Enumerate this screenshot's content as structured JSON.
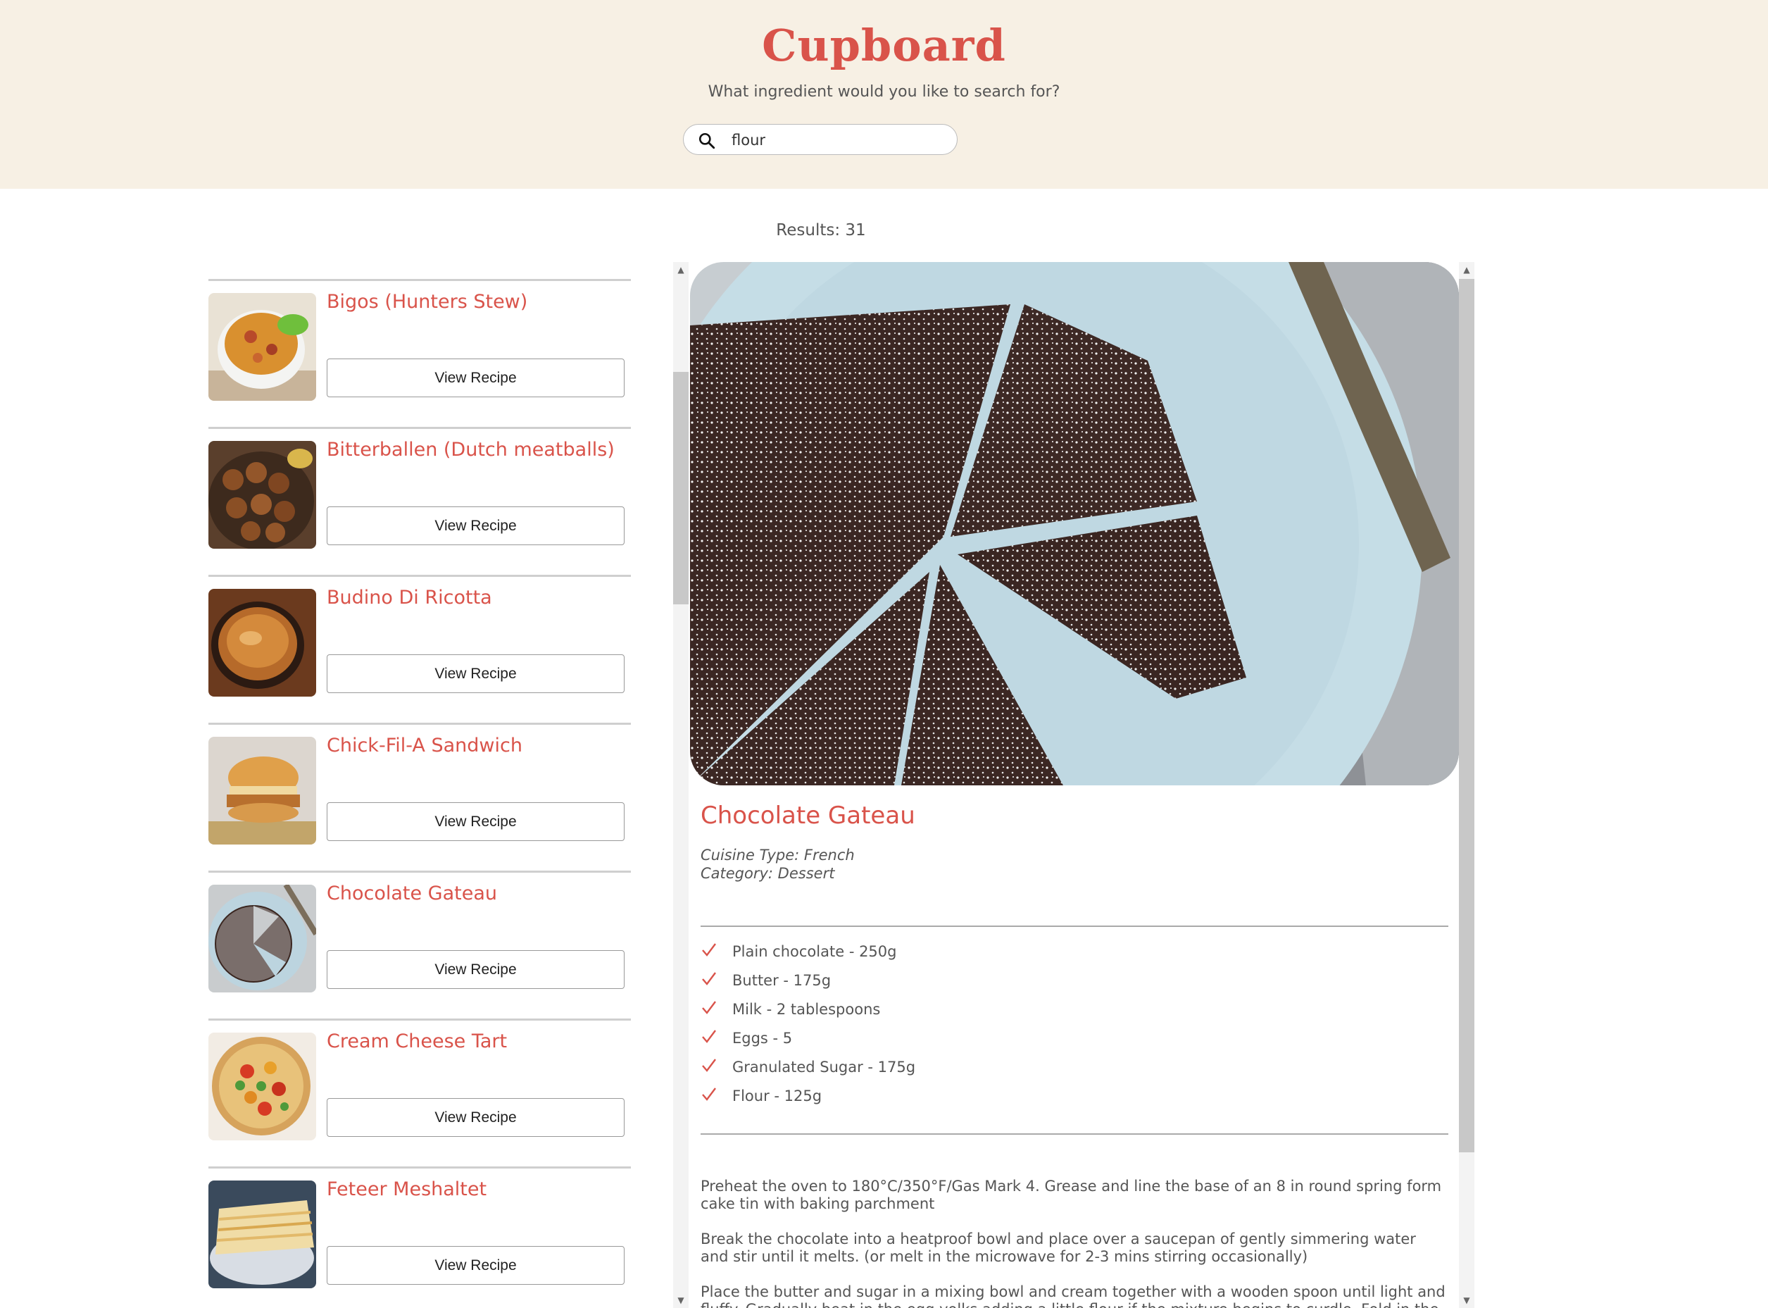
{
  "header": {
    "logo": "Cupboard",
    "subtitle": "What ingredient would you like to search for?",
    "search_value": "flour",
    "search_icon": "search-icon"
  },
  "results_label": "Results: 31",
  "recipes": [
    {
      "title": "Bigos (Hunters Stew)",
      "button": "View Recipe"
    },
    {
      "title": "Bitterballen (Dutch meatballs)",
      "button": "View Recipe"
    },
    {
      "title": "Budino Di Ricotta",
      "button": "View Recipe"
    },
    {
      "title": "Chick-Fil-A Sandwich",
      "button": "View Recipe"
    },
    {
      "title": "Chocolate Gateau",
      "button": "View Recipe"
    },
    {
      "title": "Cream Cheese Tart",
      "button": "View Recipe"
    },
    {
      "title": "Feteer Meshaltet",
      "button": "View Recipe"
    }
  ],
  "detail": {
    "title": "Chocolate Gateau",
    "cuisine": "Cuisine Type: French",
    "category": "Category: Dessert",
    "ingredients": [
      "Plain chocolate - 250g",
      "Butter - 175g",
      "Milk - 2 tablespoons",
      "Eggs - 5",
      "Granulated Sugar - 175g",
      "Flour - 125g"
    ],
    "instructions": [
      "Preheat the oven to 180°C/350°F/Gas Mark 4. Grease and line the base of an 8 in round spring form cake tin with baking parchment",
      "Break the chocolate into a heatproof bowl and place over a saucepan of gently simmering water and stir until it melts. (or melt in the microwave for 2-3 mins stirring occasionally)",
      "Place the butter and sugar in a mixing bowl and cream together with a wooden spoon until light and fluffy. Gradually beat in the egg yolks adding a little flour if the mixture begins to curdle. Fold in the"
    ]
  },
  "colors": {
    "accent": "#d9534a",
    "header_bg": "#f7f0e4"
  }
}
